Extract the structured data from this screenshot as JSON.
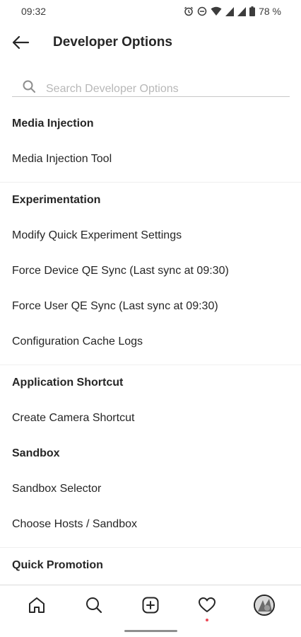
{
  "status_bar": {
    "time": "09:32",
    "battery": "78 %"
  },
  "header": {
    "title": "Developer Options"
  },
  "search": {
    "placeholder": "Search Developer Options",
    "value": ""
  },
  "sections": [
    {
      "title": "Media Injection",
      "items": [
        "Media Injection Tool"
      ]
    },
    {
      "title": "Experimentation",
      "items": [
        "Modify Quick Experiment Settings",
        "Force Device QE Sync (Last sync at 09:30)",
        "Force User QE Sync (Last sync at 09:30)",
        "Configuration Cache Logs"
      ]
    },
    {
      "title": "Application Shortcut",
      "items": [
        "Create Camera Shortcut"
      ]
    },
    {
      "title": "Sandbox",
      "items": [
        "Sandbox Selector",
        "Choose Hosts / Sandbox"
      ]
    },
    {
      "title": "Quick Promotion",
      "items": []
    }
  ],
  "bottom_nav": {
    "items": [
      "home-icon",
      "search-icon",
      "new-post-icon",
      "activity-heart-icon",
      "profile-avatar"
    ],
    "activity_badge_color": "#ed4956"
  }
}
